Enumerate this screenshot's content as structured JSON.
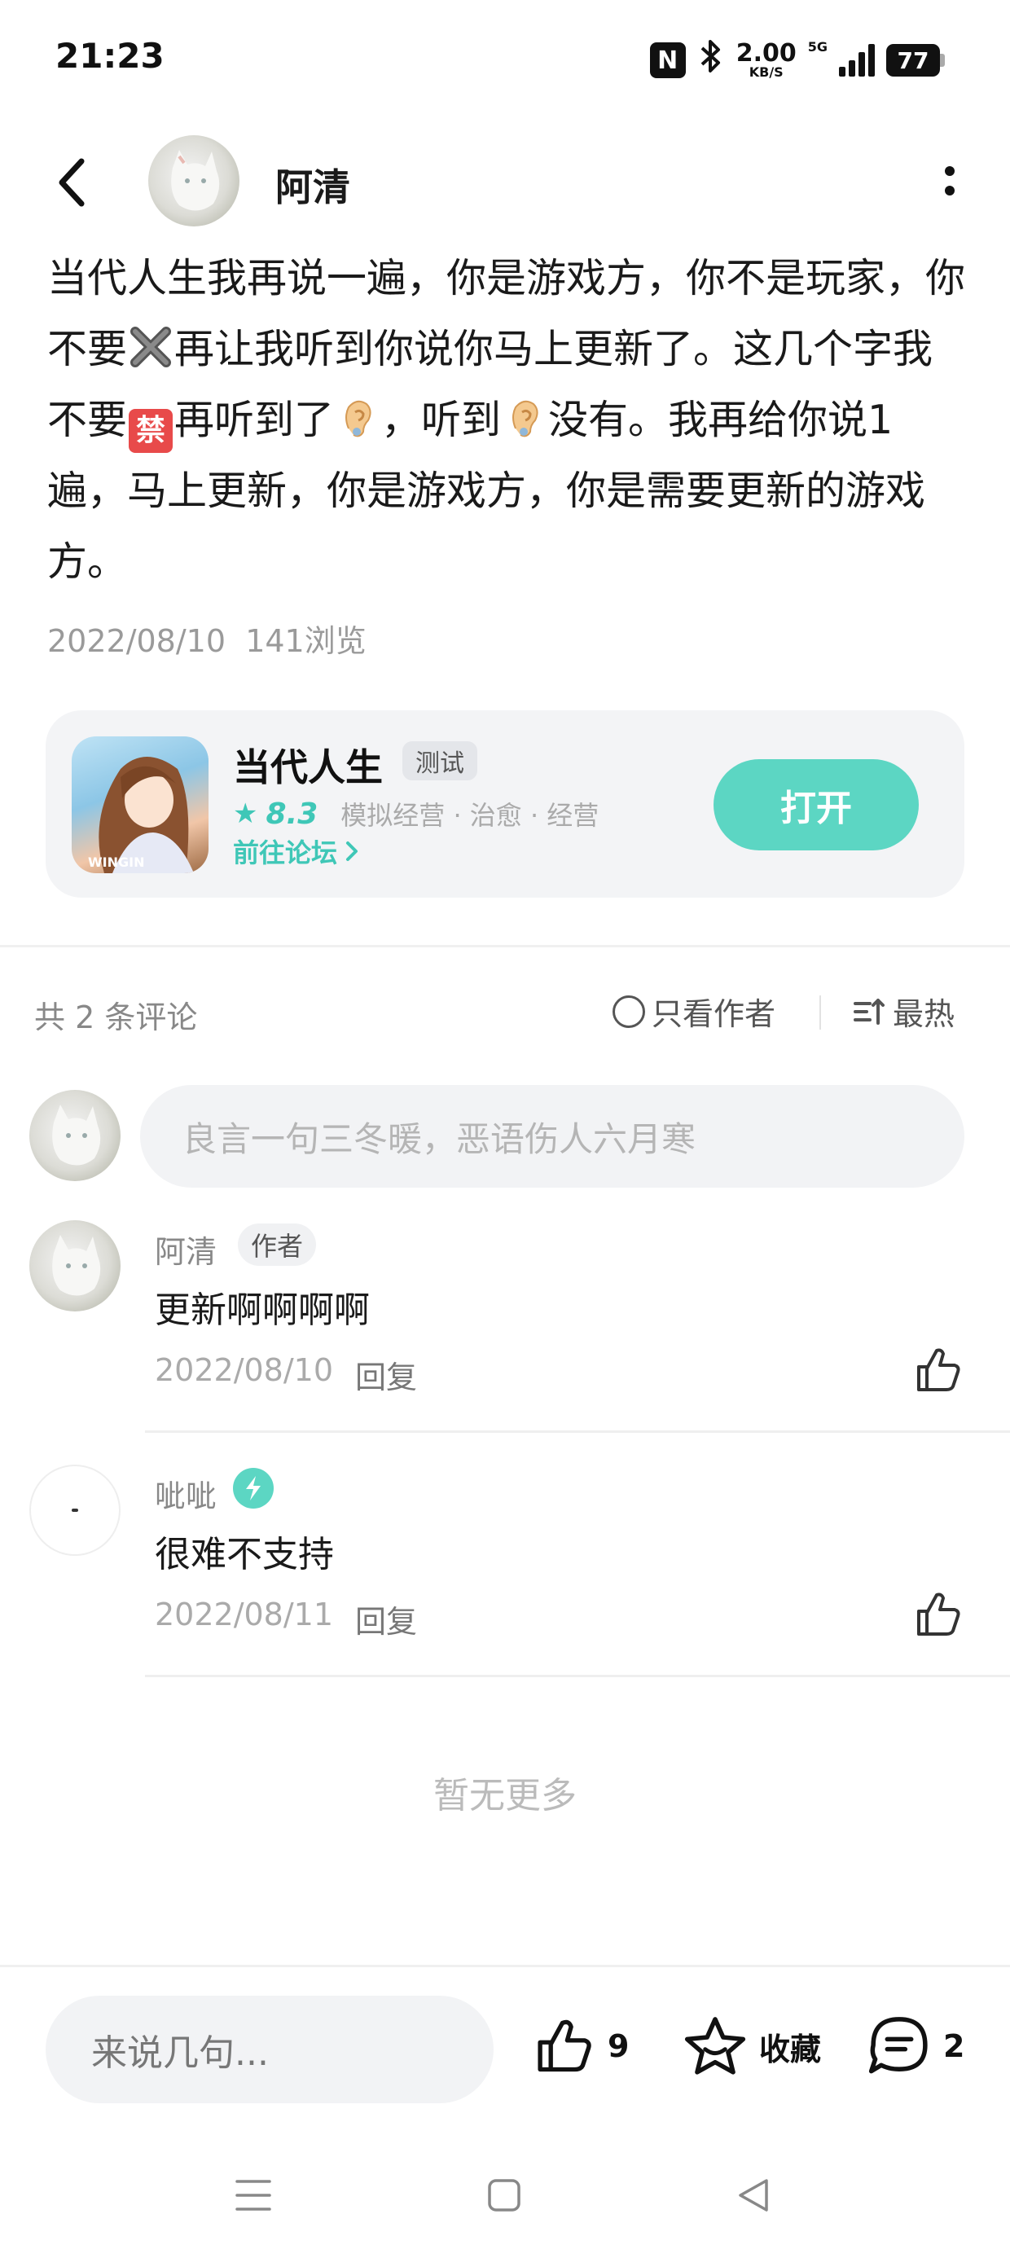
{
  "status_bar": {
    "time": "21:23",
    "nfc": "N",
    "net_speed": "2.00",
    "net_unit": "KB/S",
    "network_type": "5G",
    "battery": "77"
  },
  "header": {
    "author_name": "阿清"
  },
  "post": {
    "text_1": "当代人生我再说一遍，你是游戏方，你不是玩家，你不要",
    "text_2": "再让我听到你说你马上更新了。这几个字我不要",
    "text_3": "再听到了",
    "text_4": "，听到",
    "text_5": "没有。我再给你说1遍，马上更新，你是游戏方，你是需要更新的游戏方。",
    "forbidden_char": "禁",
    "date": "2022/08/10",
    "views": "141浏览"
  },
  "game_card": {
    "title": "当代人生",
    "badge": "测试",
    "rating": "8.3",
    "tags": "模拟经营 · 治愈 · 经营",
    "forum_link": "前往论坛",
    "open_button": "打开",
    "thumb_text": "WINGIN"
  },
  "comments_header": {
    "count": "共 2 条评论",
    "author_only": "只看作者",
    "sort": "最热"
  },
  "comment_input": {
    "placeholder": "良言一句三冬暖，恶语伤人六月寒"
  },
  "comments": [
    {
      "name": "阿清",
      "tag": "作者",
      "text": "更新啊啊啊啊",
      "date": "2022/08/10",
      "reply": "回复"
    },
    {
      "name": "呲呲",
      "text": "很难不支持",
      "date": "2022/08/11",
      "reply": "回复"
    }
  ],
  "footer": {
    "no_more": "暂无更多"
  },
  "bottom_bar": {
    "input_placeholder": "来说几句...",
    "like_count": "9",
    "favorite_label": "收藏",
    "comment_count": "2"
  },
  "colors": {
    "accent": "#5cd6c3",
    "accent_text": "#3fc7b7",
    "card_bg": "#f3f4f6"
  },
  "icons": [
    "back-arrow-icon",
    "more-icon",
    "star-icon",
    "chevron-right-icon",
    "radio-circle-icon",
    "sort-icon",
    "thumbs-up-icon",
    "star-outline-icon",
    "comment-icon",
    "menu-icon",
    "home-square-icon",
    "back-triangle-icon"
  ]
}
